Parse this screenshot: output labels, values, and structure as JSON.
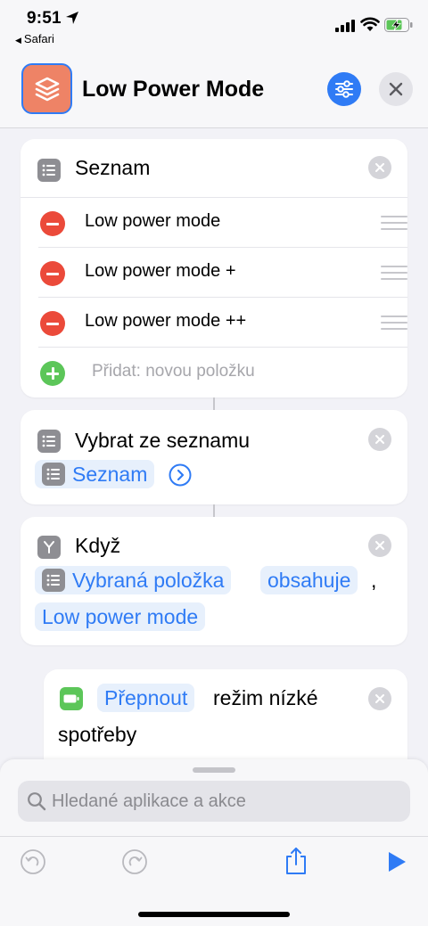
{
  "status_bar": {
    "time": "9:51",
    "back_app": "Safari"
  },
  "header": {
    "title": "Low Power Mode",
    "icons": {
      "app": "shortcut-layers-icon",
      "settings": "sliders-icon",
      "close": "close-icon"
    }
  },
  "list_card": {
    "title": "Seznam",
    "items": [
      {
        "label": "Low power mode"
      },
      {
        "label": "Low power mode +"
      },
      {
        "label": "Low power mode ++"
      }
    ],
    "add_placeholder": "Přidat: novou položku"
  },
  "choose_card": {
    "title": "Vybrat ze seznamu",
    "variable": "Seznam"
  },
  "if_card": {
    "title": "Když",
    "variable": "Vybraná položka",
    "condition": "obsahuje",
    "comma": ",",
    "value": "Low power mode"
  },
  "toggle_card": {
    "action": "Přepnout",
    "text_line1": "režim nízké",
    "text_line2": "spotřeby"
  },
  "sheet": {
    "search_placeholder": "Hledané aplikace a akce"
  },
  "colors": {
    "accent": "#2f7bf5",
    "chip_bg": "#e7f0fc",
    "app_icon": "#ee8366",
    "delete": "#eb4a3a",
    "add": "#5cc659",
    "battery_green": "#5cc659"
  }
}
